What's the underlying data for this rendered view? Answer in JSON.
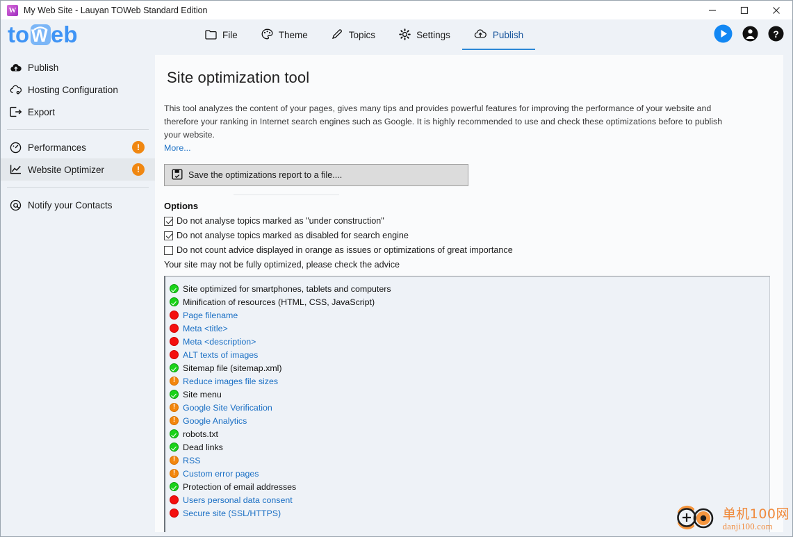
{
  "window": {
    "title": "My Web Site - Lauyan TOWeb Standard Edition",
    "app_icon": "toweb-app-icon",
    "controls": {
      "minimize": "minimize-icon",
      "maximize": "maximize-icon",
      "close": "close-icon"
    }
  },
  "brand": {
    "logo_text": "toWeb"
  },
  "toolbar": {
    "tabs": [
      {
        "label": "File",
        "icon": "folder-icon",
        "active": false
      },
      {
        "label": "Theme",
        "icon": "palette-icon",
        "active": false
      },
      {
        "label": "Topics",
        "icon": "pencil-icon",
        "active": false
      },
      {
        "label": "Settings",
        "icon": "gear-icon",
        "active": false
      },
      {
        "label": "Publish",
        "icon": "cloud-upload-icon",
        "active": true
      }
    ],
    "actions": [
      {
        "name": "preview-play-button",
        "icon": "play-circle-icon"
      },
      {
        "name": "account-button",
        "icon": "user-circle-icon"
      },
      {
        "name": "help-button",
        "icon": "help-circle-icon"
      }
    ]
  },
  "sidebar": {
    "groups": [
      {
        "items": [
          {
            "label": "Publish",
            "icon": "cloud-upload-icon",
            "badge": null,
            "selected": false
          },
          {
            "label": "Hosting Configuration",
            "icon": "cloud-gear-icon",
            "badge": null,
            "selected": false
          },
          {
            "label": "Export",
            "icon": "export-icon",
            "badge": null,
            "selected": false
          }
        ]
      },
      {
        "items": [
          {
            "label": "Performances",
            "icon": "gauge-icon",
            "badge": "!",
            "selected": false
          },
          {
            "label": "Website Optimizer",
            "icon": "chart-line-icon",
            "badge": "!",
            "selected": true
          }
        ]
      },
      {
        "items": [
          {
            "label": "Notify your Contacts",
            "icon": "at-sign-icon",
            "badge": null,
            "selected": false
          }
        ]
      }
    ]
  },
  "main": {
    "title": "Site optimization tool",
    "description": "This tool analyzes the content of your pages, gives many tips and provides powerful features for improving the performance of your website and therefore your ranking in Internet search engines such as Google. It is highly recommended to use and check these optimizations before to publish your website.",
    "more_link": "More...",
    "save_button": {
      "label": "Save the optimizations report to a file....",
      "icon": "save-report-icon"
    },
    "options_title": "Options",
    "options": [
      {
        "label": "Do not analyse topics marked as \"under construction\"",
        "checked": true
      },
      {
        "label": "Do not analyse topics marked as disabled for search engine",
        "checked": true
      },
      {
        "label": "Do not count advice displayed in orange as issues or optimizations of great importance",
        "checked": false
      }
    ],
    "advice_note": "Your site may not be fully optimized, please check the advice",
    "results": [
      {
        "label": "Site optimized for smartphones, tablets and computers",
        "status": "ok"
      },
      {
        "label": "Minification of resources (HTML, CSS, JavaScript)",
        "status": "ok"
      },
      {
        "label": "Page filename",
        "status": "err"
      },
      {
        "label": "Meta <title>",
        "status": "err"
      },
      {
        "label": "Meta <description>",
        "status": "err"
      },
      {
        "label": "ALT texts of images",
        "status": "err"
      },
      {
        "label": "Sitemap file (sitemap.xml)",
        "status": "ok"
      },
      {
        "label": "Reduce images file sizes",
        "status": "warn"
      },
      {
        "label": "Site menu",
        "status": "ok"
      },
      {
        "label": "Google Site Verification",
        "status": "warn"
      },
      {
        "label": "Google Analytics",
        "status": "warn"
      },
      {
        "label": "robots.txt",
        "status": "ok"
      },
      {
        "label": "Dead links",
        "status": "ok"
      },
      {
        "label": "RSS",
        "status": "warn"
      },
      {
        "label": "Custom error pages",
        "status": "warn"
      },
      {
        "label": "Protection of email addresses",
        "status": "ok"
      },
      {
        "label": "Users personal data consent",
        "status": "err"
      },
      {
        "label": "Secure site (SSL/HTTPS)",
        "status": "err"
      }
    ]
  },
  "watermark": {
    "cn": "单机100网",
    "en": "danji100.com"
  },
  "colors": {
    "accent": "#2b87d6",
    "link": "#1a6fc4",
    "ok": "#19d319",
    "warn": "#f3860d",
    "error": "#f40f0f",
    "badge": "#f08711",
    "sidebar_bg": "#eef2f7",
    "content_bg": "#fafbfc"
  }
}
